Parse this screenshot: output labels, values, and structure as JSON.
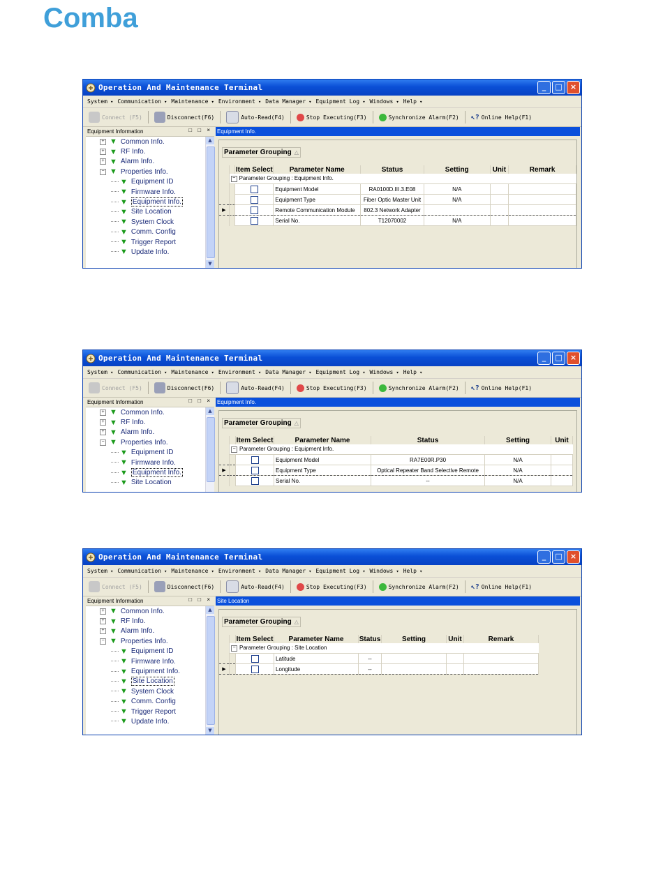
{
  "logo": "Comba",
  "common": {
    "title": "Operation And Maintenance Terminal",
    "menu": [
      "System",
      "Communication",
      "Maintenance",
      "Environment",
      "Data Manager",
      "Equipment Log",
      "Windows",
      "Help"
    ],
    "toolbar": {
      "connect": "Connect (F5)",
      "disconnect": "Disconnect(F6)",
      "auto_read": "Auto-Read(F4)",
      "stop": "Stop Executing(F3)",
      "sync": "Synchronize Alarm(F2)",
      "help": "Online Help(F1)"
    },
    "left_header": "Equipment Information",
    "left_header_controls": "□ □ ×",
    "group_label": "Parameter Grouping",
    "tree": {
      "common": "Common Info.",
      "rf": "RF Info.",
      "alarm": "Alarm Info.",
      "props": "Properties Info.",
      "eq_id": "Equipment ID",
      "firmware": "Firmware Info.",
      "eq_info": "Equipment Info.",
      "site": "Site Location",
      "clock": "System Clock",
      "comm": "Comm. Config",
      "trigger": "Trigger Report",
      "update": "Update Info."
    }
  },
  "win1": {
    "right_header": "Equipment Info.",
    "headers": [
      "Item Select",
      "Parameter Name",
      "Status",
      "Setting",
      "Unit",
      "Remark"
    ],
    "group_row": "Parameter Grouping : Equipment Info.",
    "rows": [
      [
        "Equipment Model",
        "RA0100D.III.3.E08",
        "N/A",
        "",
        ""
      ],
      [
        "Equipment Type",
        "Fiber Optic Master Unit",
        "N/A",
        "",
        ""
      ],
      [
        "Remote Communication Module",
        "802.3 Network Adapter",
        "",
        "",
        ""
      ],
      [
        "Serial No.",
        "T12070002",
        "N/A",
        "",
        ""
      ]
    ]
  },
  "win2": {
    "right_header": "Equipment Info.",
    "headers": [
      "Item Select",
      "Parameter Name",
      "Status",
      "Setting",
      "Unit"
    ],
    "group_row": "Parameter Grouping : Equipment Info.",
    "rows": [
      [
        "Equipment Model",
        "RA7E00R.P30",
        "N/A",
        ""
      ],
      [
        "Equipment Type",
        "Optical Repeater Band Selective Remote",
        "N/A",
        ""
      ],
      [
        "Serial No.",
        "--",
        "N/A",
        ""
      ]
    ]
  },
  "win3": {
    "right_header": "Site Location",
    "headers": [
      "Item Select",
      "Parameter Name",
      "Status",
      "Setting",
      "Unit",
      "Remark"
    ],
    "group_row": "Parameter Grouping : Site Location",
    "rows": [
      [
        "Latitude",
        "--",
        "",
        "",
        ""
      ],
      [
        "Longitude",
        "--",
        "",
        "",
        ""
      ]
    ]
  }
}
